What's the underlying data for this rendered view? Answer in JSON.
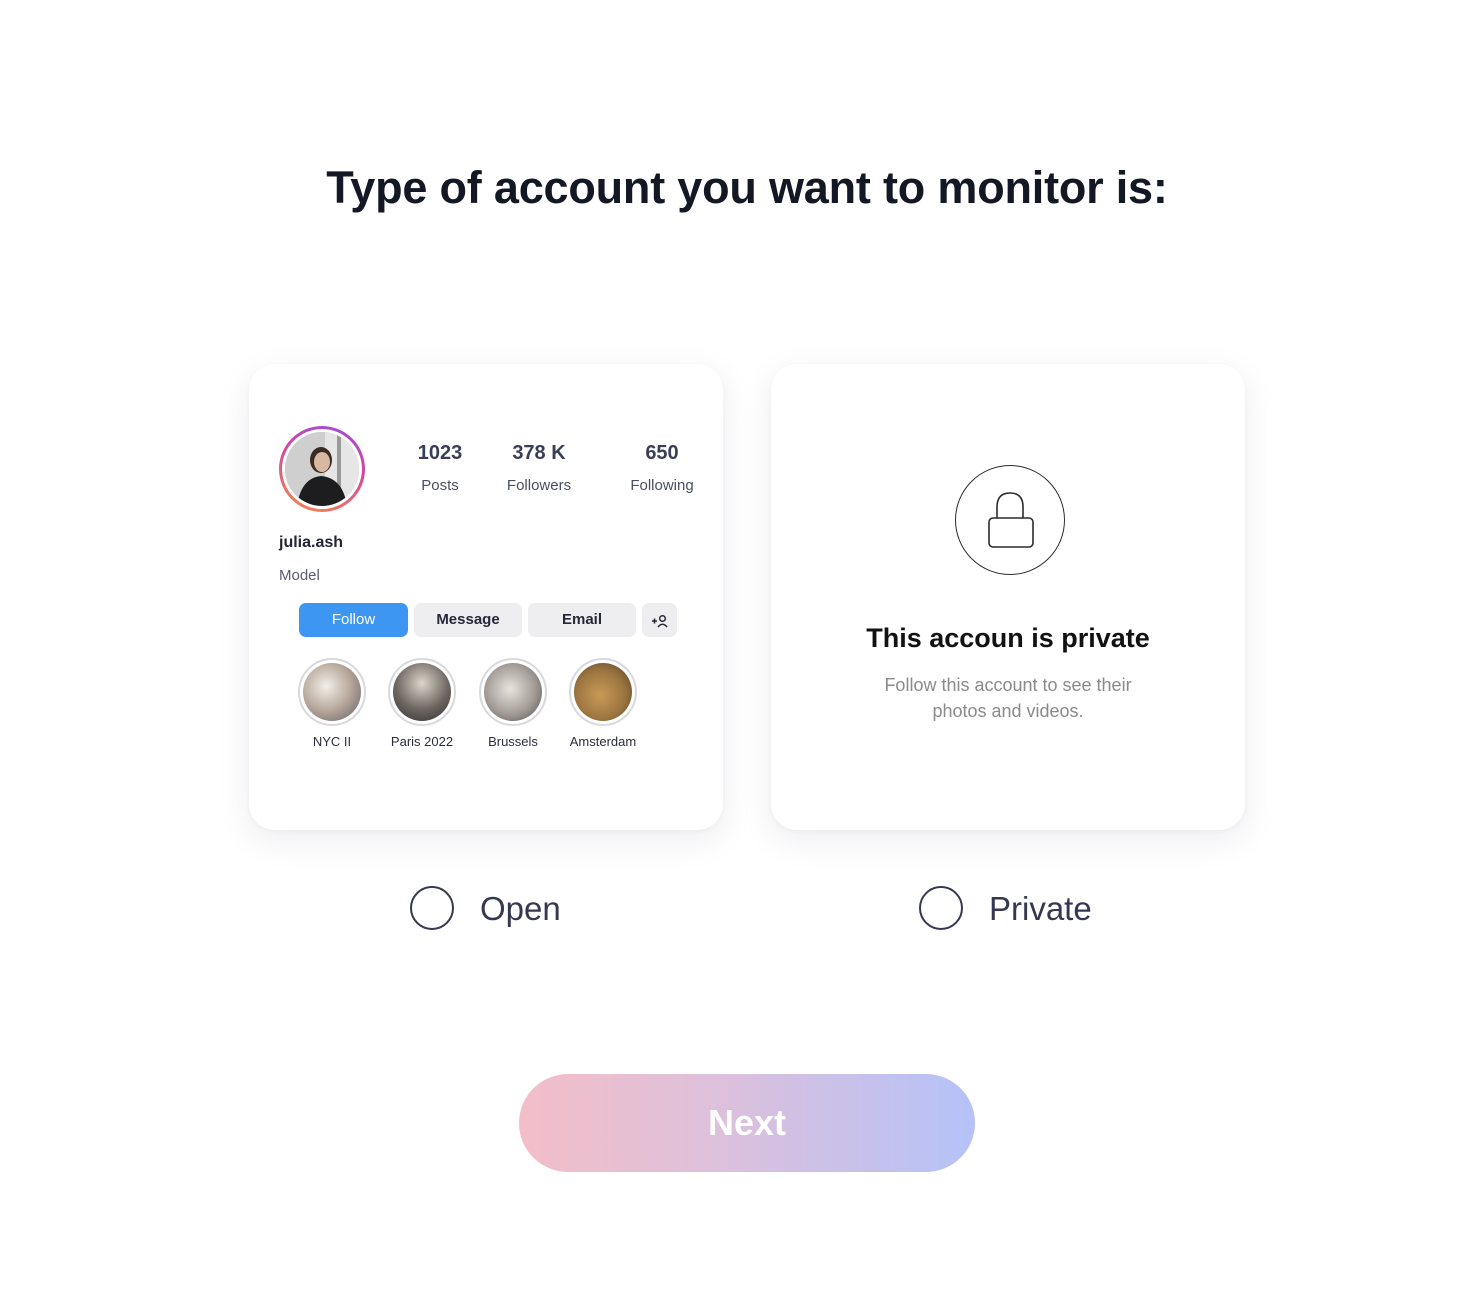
{
  "title": "Type of account you want to monitor is:",
  "open_card": {
    "stats": [
      {
        "value": "1023",
        "label": "Posts"
      },
      {
        "value": "378 K",
        "label": "Followers"
      },
      {
        "value": "650",
        "label": "Following"
      }
    ],
    "username": "julia.ash",
    "bio": "Model",
    "buttons": {
      "follow": "Follow",
      "message": "Message",
      "email": "Email",
      "add_person": "+"
    },
    "stories": [
      {
        "label": "NYC II"
      },
      {
        "label": "Paris 2022"
      },
      {
        "label": "Brussels"
      },
      {
        "label": "Amsterdam"
      }
    ]
  },
  "private_card": {
    "title": "This accoun is private",
    "subtitle": "Follow this account to see their photos and videos."
  },
  "options": {
    "open": "Open",
    "private": "Private"
  },
  "next_button": "Next",
  "colors": {
    "follow_blue": "#3d97f2",
    "radio_border": "#363853",
    "next_gradient_start": "#f3bec8",
    "next_gradient_end": "#b5c2f8"
  }
}
